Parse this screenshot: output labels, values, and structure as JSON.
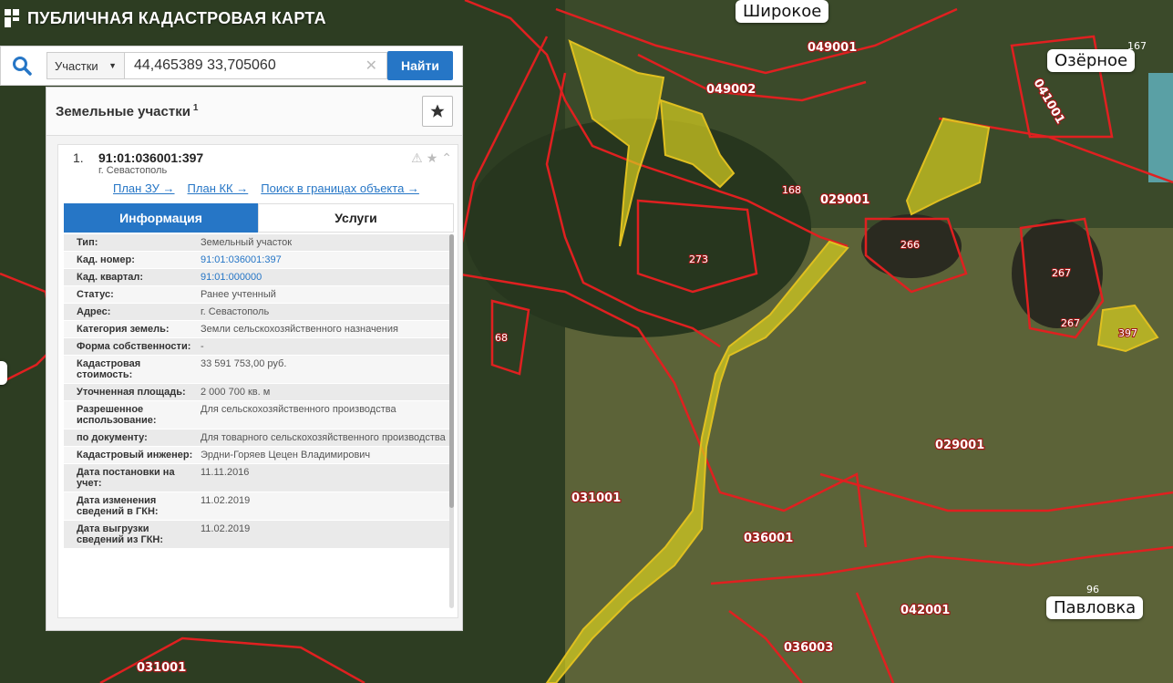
{
  "app": {
    "title": "ПУБЛИЧНАЯ КАДАСТРОВАЯ КАРТА"
  },
  "search": {
    "type_selected": "Участки",
    "query": "44,465389 33,705060",
    "find_label": "Найти"
  },
  "panel": {
    "title": "Земельные участки",
    "count": "1",
    "result": {
      "number": "1.",
      "cad_number": "91:01:036001:397",
      "city": "г. Севастополь",
      "links": [
        "План ЗУ →",
        "План КК →",
        "Поиск в границах объекта →"
      ]
    },
    "tabs": [
      "Информация",
      "Услуги"
    ],
    "rows": [
      {
        "k": "Тип:",
        "v": "Земельный участок"
      },
      {
        "k": "Кад. номер:",
        "v": "91:01:036001:397",
        "link": true
      },
      {
        "k": "Кад. квартал:",
        "v": "91:01:000000",
        "link": true
      },
      {
        "k": "Статус:",
        "v": "Ранее учтенный"
      },
      {
        "k": "Адрес:",
        "v": "г. Севастополь"
      },
      {
        "k": "Категория земель:",
        "v": "Земли сельскохозяйственного назначения"
      },
      {
        "k": "Форма собственности:",
        "v": "-"
      },
      {
        "k": "Кадастровая стоимость:",
        "v": "33 591 753,00 руб."
      },
      {
        "k": "Уточненная площадь:",
        "v": "2 000 700 кв. м"
      },
      {
        "k": "Разрешенное использование:",
        "v": "Для сельскохозяйственного производства"
      },
      {
        "k": "по документу:",
        "v": "Для товарного сельскохозяйственного производства"
      },
      {
        "k": "Кадастровый инженер:",
        "v": "Эрдни-Горяев Цецен Владимирович"
      },
      {
        "k": "Дата постановки на учет:",
        "v": "11.11.2016"
      },
      {
        "k": "Дата изменения сведений в ГКН:",
        "v": "11.02.2019"
      },
      {
        "k": "Дата выгрузки сведений из ГКН:",
        "v": "11.02.2019"
      }
    ]
  },
  "map": {
    "places": [
      "Широкое",
      "Озёрное",
      "Павловка"
    ],
    "place_numbers": [
      "167",
      "96"
    ],
    "quarters": [
      "049001",
      "049002",
      "029001",
      "029001",
      "036001",
      "031001",
      "031001",
      "042001",
      "036003",
      "041001"
    ],
    "plots": [
      "168",
      "273",
      "266",
      "267",
      "267",
      "397",
      "68"
    ],
    "colors": {
      "boundary": "#e02020",
      "selected": "#e0d020"
    }
  }
}
